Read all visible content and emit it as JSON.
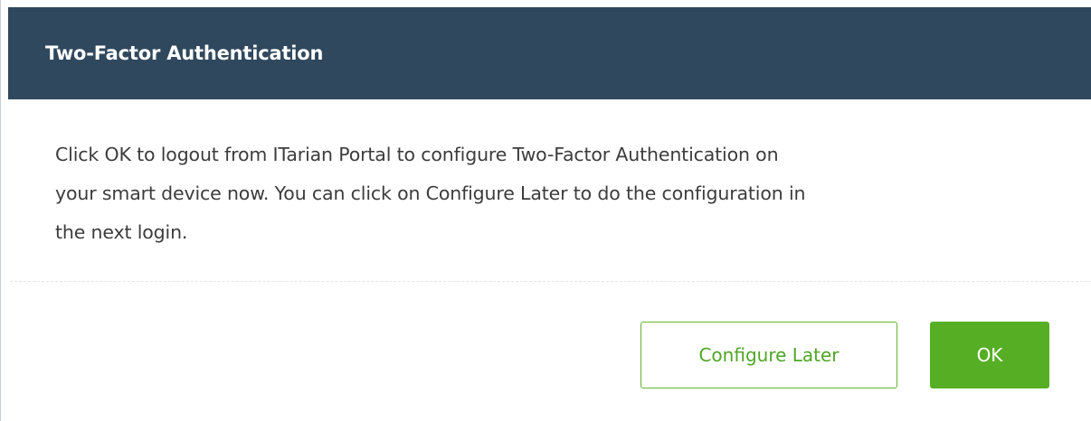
{
  "dialog": {
    "title": "Two-Factor Authentication",
    "message_lines": [
      "Click OK to logout from ITarian Portal to configure Two-Factor Authentication on",
      "your smart device now. You can click on Configure Later to do the configuration in",
      "the next login."
    ],
    "buttons": {
      "configure_later": "Configure Later",
      "ok": "OK"
    }
  },
  "colors": {
    "header_bg": "#30485d",
    "accent_green": "#56ae24",
    "body_text": "#3c3c3c"
  }
}
